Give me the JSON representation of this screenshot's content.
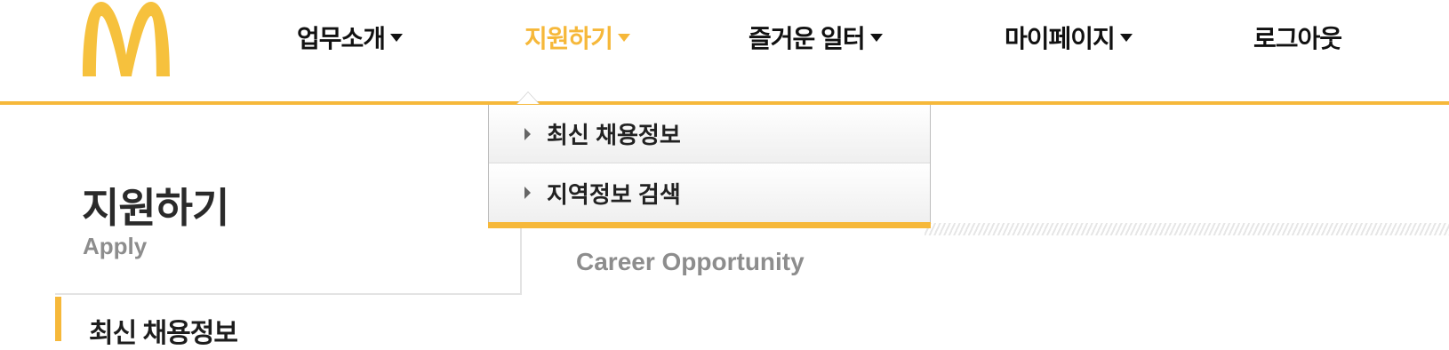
{
  "brand": {
    "logo_icon": "golden-arches-logo-icon",
    "accent_color": "#f6b83a"
  },
  "nav": {
    "items": [
      {
        "label": "업무소개",
        "has_dropdown": true,
        "active": false
      },
      {
        "label": "지원하기",
        "has_dropdown": true,
        "active": true
      },
      {
        "label": "즐거운 일터",
        "has_dropdown": true,
        "active": false
      },
      {
        "label": "마이페이지",
        "has_dropdown": true,
        "active": false
      },
      {
        "label": "로그아웃",
        "has_dropdown": false,
        "active": false
      }
    ]
  },
  "dropdown": {
    "items": [
      {
        "label": "최신 채용정보"
      },
      {
        "label": "지역정보 검색"
      }
    ]
  },
  "side": {
    "title": "지원하기",
    "subtitle": "Apply",
    "active_item": "최신 채용정보"
  },
  "content": {
    "subtitle": "Career Opportunity"
  }
}
